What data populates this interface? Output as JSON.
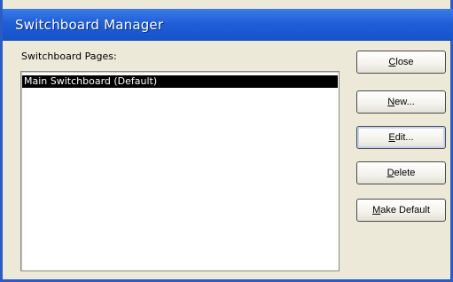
{
  "window": {
    "title": "Switchboard Manager"
  },
  "pages_label": "Switchboard Pages:",
  "pages": [
    {
      "label": "Main Switchboard (Default)",
      "selected": true
    }
  ],
  "buttons": {
    "close": {
      "label": "Close",
      "mnemonic": "C",
      "rest": "lose"
    },
    "new": {
      "label": "New...",
      "mnemonic": "N",
      "rest": "ew..."
    },
    "edit": {
      "label": "Edit...",
      "mnemonic": "E",
      "rest": "dit..."
    },
    "delete": {
      "label": "Delete",
      "mnemonic": "D",
      "rest": "elete"
    },
    "make_default": {
      "label": "Make Default",
      "mnemonic": "M",
      "rest": "ake Default"
    }
  },
  "colors": {
    "titlebar": "#1f5ed6",
    "selection": "#000000",
    "dialog_bg": "#ece9d8"
  }
}
